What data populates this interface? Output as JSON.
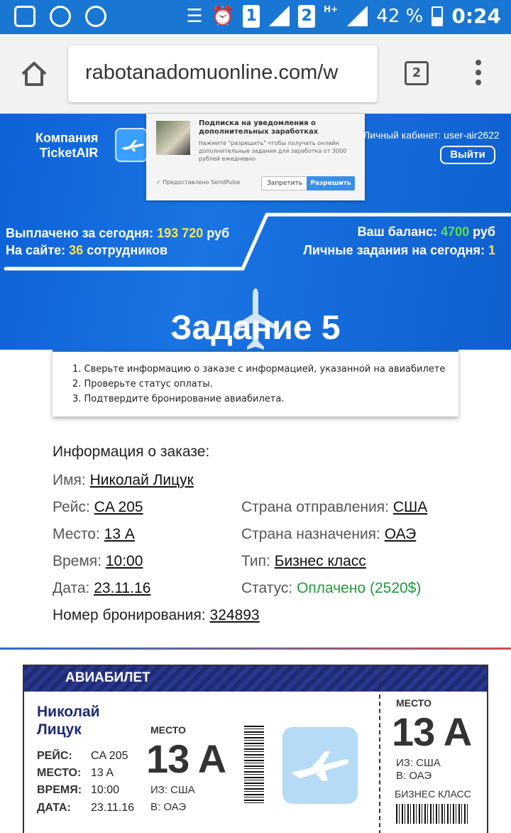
{
  "status_bar": {
    "signal_label_1": "1",
    "network_type": "H+",
    "signal_label_2": "2",
    "battery_percent": "42 %",
    "time": "0:24"
  },
  "browser": {
    "url": "rabotanadomuonline.com/w",
    "tab_count": "2"
  },
  "site": {
    "company_line1": "Компания",
    "company_line2": "TicketAIR",
    "cabinet_label": "Личный кабинет: user-air2622",
    "logout_label": "Выйти",
    "paid_today_label": "Выплачено за сегодня:",
    "paid_today_value": "193 720",
    "paid_today_unit": "руб",
    "staff_label": "На сайте:",
    "staff_value": "36",
    "staff_unit": "сотрудников",
    "balance_label": "Ваш баланс:",
    "balance_value": "4700",
    "balance_unit": "руб",
    "personal_tasks_label": "Личные задания на сегодня:",
    "personal_tasks_value": "1",
    "task_title": "Задание 5"
  },
  "notification": {
    "title": "Подписка на уведомления о дополнительных заработках",
    "body": "Нажмите \"разрешить\" чтобы получать онлайн дополнительные задания для заработка от 3000 рублей ежедневно",
    "brand": "Предоставлено SendPulse",
    "deny_label": "Запретить",
    "allow_label": "Разрешить"
  },
  "instructions": [
    "1. Сверьте информацию о заказе с информацией, указанной на авиабилете",
    "2. Проверьте статус оплаты.",
    "3. Подтвердите бронирование авиабилета."
  ],
  "order": {
    "heading": "Информация о заказе:",
    "name_label": "Имя:",
    "name_value": "Николай Лицук",
    "flight_label": "Рейс:",
    "flight_value": "CA 205",
    "seat_label": "Место:",
    "seat_value": "13 A",
    "time_label": "Время:",
    "time_value": "10:00",
    "date_label": "Дата:",
    "date_value": "23.11.16",
    "from_label": "Страна отправления:",
    "from_value": "США",
    "to_label": "Страна назначения:",
    "to_value": "ОАЭ",
    "type_label": "Тип:",
    "type_value": "Бизнес класс",
    "status_label": "Статус:",
    "status_value": "Оплачено (2520$)",
    "booking_label": "Номер бронирования:",
    "booking_value": "324893"
  },
  "ticket": {
    "header": "АВИАБИЛЕТ",
    "name_line1": "Николай",
    "name_line2": "Лицук",
    "flight_label": "РЕЙС:",
    "flight_value": "CA 205",
    "seat_label": "МЕСТО:",
    "seat_value": "13 A",
    "time_label": "ВРЕМЯ:",
    "time_value": "10:00",
    "date_label": "ДАТА:",
    "date_value": "23.11.16",
    "seat_caption": "МЕСТО",
    "seat_big": "13 A",
    "from": "ИЗ: США",
    "to": "В: ОАЭ",
    "stub_seat_caption": "МЕСТО",
    "stub_seat_big": "13 A",
    "stub_from": "ИЗ: США",
    "stub_to": "В: ОАЭ",
    "stub_class": "БИЗНЕС КЛАСС"
  },
  "colors": {
    "hero_blue": "#1a74e3",
    "yellow": "#ffe44d",
    "green": "#55e04a",
    "paid_green": "#1e9a3a",
    "ticket_navy": "#1f2a74"
  }
}
